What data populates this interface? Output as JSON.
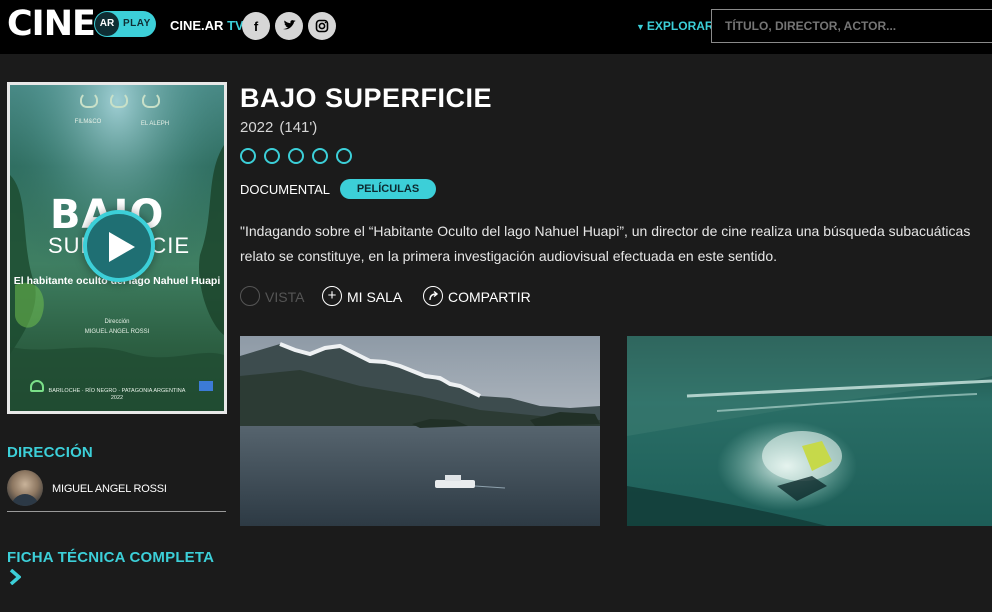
{
  "header": {
    "logo_text": "CINE",
    "logo_badge": "AR",
    "logo_play": "PLAY",
    "cinear_tv_main": "CINE.AR",
    "cinear_tv_suffix": " TV",
    "social": [
      {
        "icon": "facebook-icon",
        "glyph": "f"
      },
      {
        "icon": "twitter-icon",
        "glyph": "🐦"
      },
      {
        "icon": "instagram-icon",
        "glyph": "◎"
      }
    ],
    "explorar_label": "EXPLORAR",
    "search_placeholder": "TÍTULO, DIRECTOR, ACTOR..."
  },
  "poster": {
    "festival_text_left": "FILM&CO",
    "festival_text_right": "EL ALEPH",
    "title_line1": "BAJO",
    "title_line2": "SUPERFICIE",
    "subtitle": "El habitante oculto del lago Nahuel Huapi",
    "director_label": "Dirección",
    "director_name": "MIGUEL ANGEL ROSSI",
    "footer": "BARILOCHE · RÍO NEGRO · PATAGONIA ARGENTINA",
    "footer_year": "2022"
  },
  "movie": {
    "title": "BAJO SUPERFICIE",
    "year": "2022",
    "duration": "(141')",
    "rating": {
      "value": 0,
      "max": 5
    },
    "genre": "DOCUMENTAL",
    "category": "PELÍCULAS",
    "synopsis_line1": "\"Indagando sobre el “Habitante Oculto del lago Nahuel Huapi”, un director de cine realiza una búsqueda subacuáticas",
    "synopsis_line2": "relato se constituye, en la primera investigación audiovisual efectuada en este sentido."
  },
  "actions": {
    "vista": "VISTA",
    "mi_sala": "MI SALA",
    "compartir": "COMPARTIR"
  },
  "sidebar": {
    "direccion_title": "DIRECCIÓN",
    "director_name": "MIGUEL ANGEL ROSSI",
    "ficha_title": "FICHA TÉCNICA COMPLETA"
  },
  "colors": {
    "accent": "#3ccfd8",
    "background": "#1b1b1b",
    "header": "#000000"
  }
}
